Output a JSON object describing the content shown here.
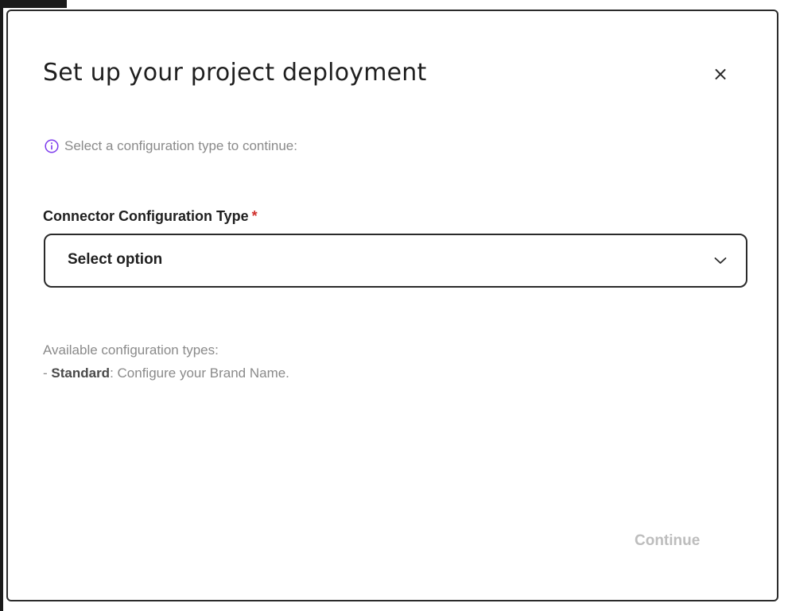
{
  "dialog": {
    "title": "Set up your project deployment",
    "close_label": "×",
    "hint": "Select a configuration type to continue:",
    "field": {
      "label": "Connector Configuration Type",
      "required_mark": "*",
      "selected_value": "Select option"
    },
    "description": {
      "heading": "Available configuration types:",
      "prefix": "- ",
      "type_name": "Standard",
      "type_desc": ": Configure your Brand Name."
    },
    "continue_label": "Continue"
  },
  "colors": {
    "info_icon": "#7c3aed",
    "required": "#d0312d",
    "continue_disabled": "#bdbdbd"
  },
  "icons": {
    "info": "info-circle-icon",
    "close": "close-icon",
    "dropdown": "chevron-down-icon"
  }
}
